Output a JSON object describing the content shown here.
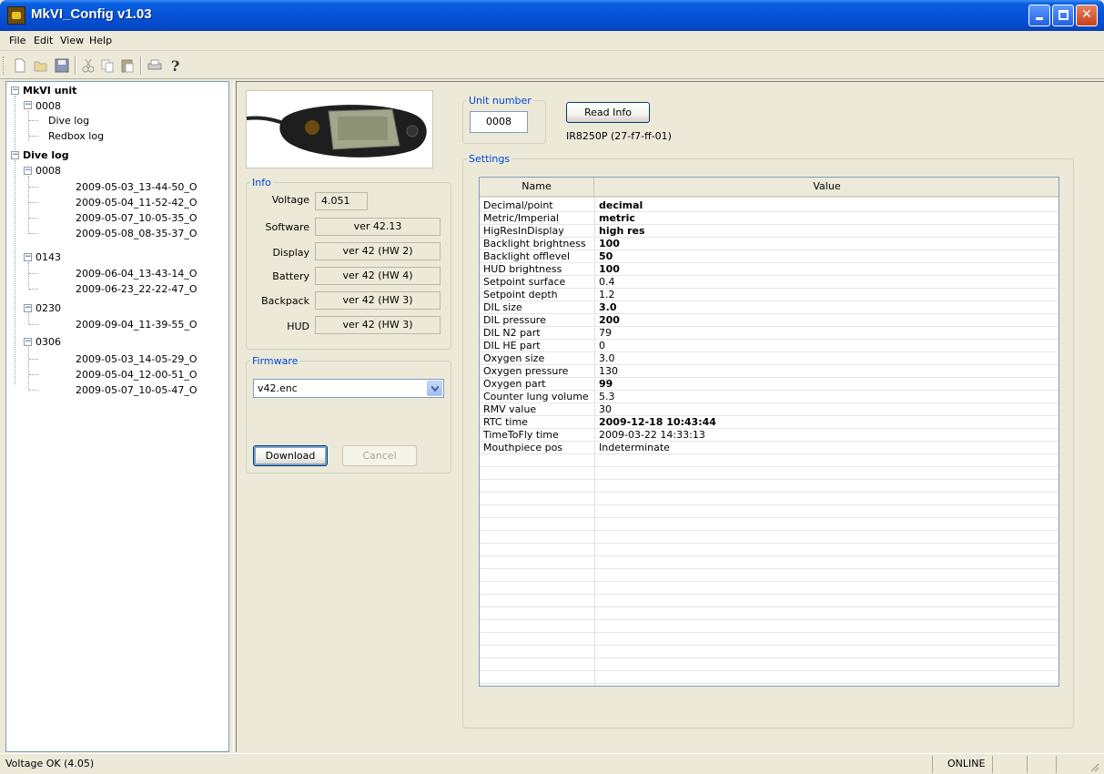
{
  "window": {
    "title": "MkVI_Config v1.03"
  },
  "menu": [
    "File",
    "Edit",
    "View",
    "Help"
  ],
  "toolbar": {
    "icons": [
      "new-icon",
      "open-icon",
      "save-icon",
      "cut-icon",
      "copy-icon",
      "paste-icon",
      "print-icon",
      "help-icon"
    ]
  },
  "tree": {
    "root1": {
      "label": "MkVI unit",
      "unit": "0008",
      "children": [
        "Dive log",
        "Redbox log"
      ]
    },
    "root2": {
      "label": "Dive log",
      "groups": [
        {
          "label": "0008",
          "items": [
            "2009-05-03_13-44-50_O",
            "2009-05-04_11-52-42_O",
            "2009-05-07_10-05-35_O",
            "2009-05-08_08-35-37_O"
          ]
        },
        {
          "label": "0143",
          "items": [
            "2009-06-04_13-43-14_O",
            "2009-06-23_22-22-47_O"
          ]
        },
        {
          "label": "0230",
          "items": [
            "2009-09-04_11-39-55_O"
          ]
        },
        {
          "label": "0306",
          "items": [
            "2009-05-03_14-05-29_O",
            "2009-05-04_12-00-51_O",
            "2009-05-07_10-05-47_O"
          ]
        }
      ]
    }
  },
  "info": {
    "legend": "Info",
    "voltage_label": "Voltage",
    "voltage": "4.051",
    "software_label": "Software",
    "software": "ver 42.13",
    "display_label": "Display",
    "display": "ver 42  (HW 2)",
    "battery_label": "Battery",
    "battery": "ver 42  (HW 4)",
    "backpack_label": "Backpack",
    "backpack": "ver 42  (HW 3)",
    "hud_label": "HUD",
    "hud": "ver 42  (HW 3)"
  },
  "firmware": {
    "legend": "Firmware",
    "selected": "v42.enc",
    "download_label": "Download",
    "cancel_label": "Cancel"
  },
  "unit": {
    "legend": "Unit number",
    "number": "0008",
    "read_info_label": "Read Info",
    "device_id": "IR8250P (27-f7-ff-01)"
  },
  "settings": {
    "legend": "Settings",
    "col_name": "Name",
    "col_value": "Value",
    "rows": [
      {
        "name": "Decimal/point",
        "value": "decimal",
        "bold": true
      },
      {
        "name": "Metric/Imperial",
        "value": "metric",
        "bold": true
      },
      {
        "name": "HigResInDisplay",
        "value": "high res",
        "bold": true
      },
      {
        "name": "Backlight brightness",
        "value": "100",
        "bold": true
      },
      {
        "name": "Backlight offlevel",
        "value": "50",
        "bold": true
      },
      {
        "name": "HUD brightness",
        "value": "100",
        "bold": true
      },
      {
        "name": "Setpoint surface",
        "value": "0.4",
        "bold": false
      },
      {
        "name": "Setpoint depth",
        "value": "1.2",
        "bold": false
      },
      {
        "name": "DIL size",
        "value": "3.0",
        "bold": true
      },
      {
        "name": "DIL pressure",
        "value": "200",
        "bold": true
      },
      {
        "name": "DIL N2 part",
        "value": "79",
        "bold": false
      },
      {
        "name": "DIL HE part",
        "value": "0",
        "bold": false
      },
      {
        "name": "Oxygen size",
        "value": "3.0",
        "bold": false
      },
      {
        "name": "Oxygen pressure",
        "value": "130",
        "bold": false
      },
      {
        "name": "Oxygen part",
        "value": "99",
        "bold": true
      },
      {
        "name": "Counter lung volume",
        "value": "5.3",
        "bold": false
      },
      {
        "name": "RMV value",
        "value": "30",
        "bold": false
      },
      {
        "name": "RTC time",
        "value": "2009-12-18 10:43:44",
        "bold": true
      },
      {
        "name": "TimeToFly time",
        "value": "2009-03-22 14:33:13",
        "bold": false
      },
      {
        "name": "Mouthpiece pos",
        "value": "Indeterminate",
        "bold": false
      }
    ]
  },
  "status": {
    "message": "Voltage OK (4.05)",
    "connection": "ONLINE"
  }
}
